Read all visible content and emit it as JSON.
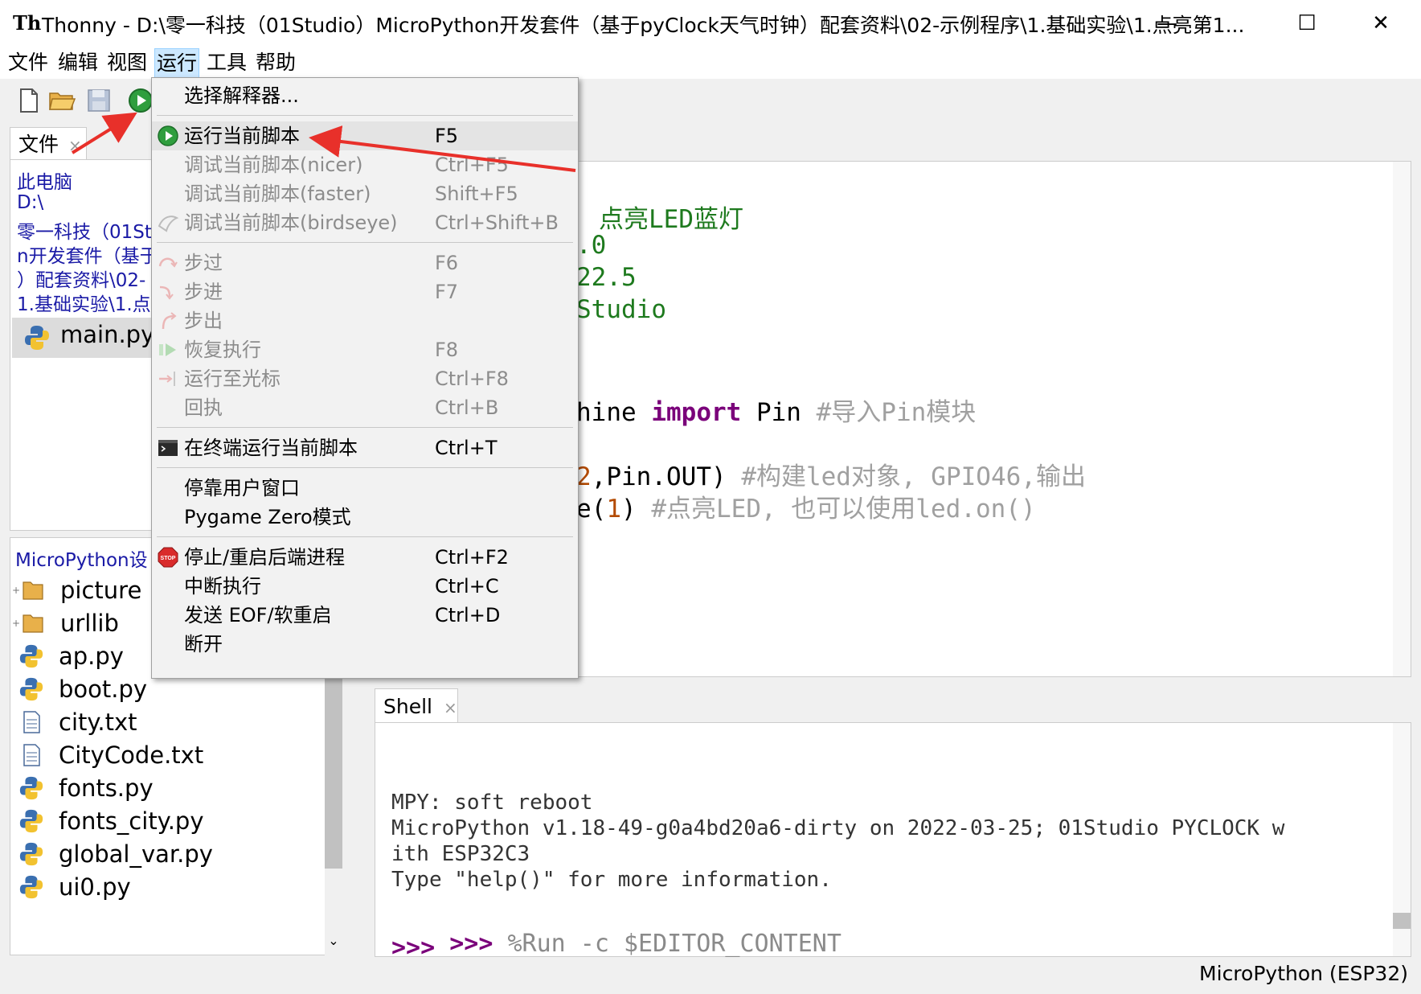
{
  "window": {
    "title": "Thonny  -  D:\\零一科技（01Studio）MicroPython开发套件（基于pyClock天气时钟）配套资料\\02-示例程序\\1.基础实验\\1.点亮第1...",
    "minimize": "—",
    "maximize": "☐",
    "close": "✕"
  },
  "menubar": [
    "文件",
    "编辑",
    "视图",
    "运行",
    "工具",
    "帮助"
  ],
  "toolbar_icons": [
    "new-file-icon",
    "open-folder-icon",
    "save-icon",
    "run-icon"
  ],
  "files_panel": {
    "tab_label": "文件",
    "tab_close": "×",
    "path_lines": [
      "此电脑",
      "D:\\",
      "零一科技（01St",
      "n开发套件（基于",
      "）配套资料\\02-",
      "1.基础实验\\1.点"
    ],
    "selected_file": "main.py"
  },
  "device_panel": {
    "title": "MicroPython设",
    "items": [
      {
        "name": "picture",
        "kind": "folder"
      },
      {
        "name": "urllib",
        "kind": "folder"
      },
      {
        "name": "ap.py",
        "kind": "python"
      },
      {
        "name": "boot.py",
        "kind": "python"
      },
      {
        "name": "city.txt",
        "kind": "text"
      },
      {
        "name": "CityCode.txt",
        "kind": "text"
      },
      {
        "name": "fonts.py",
        "kind": "python"
      },
      {
        "name": "fonts_city.py",
        "kind": "python"
      },
      {
        "name": "global_var.py",
        "kind": "python"
      },
      {
        "name": "ui0.py",
        "kind": "python"
      }
    ]
  },
  "editor": {
    "lines": [
      {
        "parts": [
          {
            "t": "点亮LED蓝灯",
            "c": "#1e7a1e"
          }
        ]
      },
      {
        "parts": [
          {
            "t": ".0",
            "c": "#1e7a1e"
          }
        ]
      },
      {
        "parts": [
          {
            "t": "22.5",
            "c": "#1e7a1e"
          }
        ]
      },
      {
        "parts": [
          {
            "t": "Studio",
            "c": "#1e7a1e"
          }
        ]
      },
      {
        "parts": [
          {
            "t": "hine ",
            "c": "#000"
          },
          {
            "t": "import",
            "c": "#7a007a"
          },
          {
            "t": " Pin ",
            "c": "#000"
          },
          {
            "t": "#导入Pin模块",
            "c": "#a0a0a0"
          }
        ]
      },
      {
        "parts": [
          {
            "t": "2",
            "c": "#b34a00"
          },
          {
            "t": ",Pin.OUT) ",
            "c": "#000"
          },
          {
            "t": "#构建led对象, GPIO46,输出",
            "c": "#a0a0a0"
          }
        ]
      },
      {
        "parts": [
          {
            "t": "e(",
            "c": "#000"
          },
          {
            "t": "1",
            "c": "#b34a00"
          },
          {
            "t": ") ",
            "c": "#000"
          },
          {
            "t": "#点亮LED, 也可以使用led.on()",
            "c": "#a0a0a0"
          }
        ]
      }
    ]
  },
  "shell": {
    "tab_label": "Shell",
    "tab_close": "×",
    "lines": [
      "MPY: soft reboot",
      "MicroPython v1.18-49-g0a4bd20a6-dirty on 2022-03-25; 01Studio PYCLOCK w",
      "ith ESP32C3",
      "Type \"help()\" for more information."
    ],
    "prompt": ">>>",
    "command": " %Run -c $EDITOR_CONTENT",
    "prompt2": ">>>"
  },
  "status": "MicroPython (ESP32)",
  "run_menu": [
    {
      "label": "选择解释器...",
      "shortcut": "",
      "disabled": false,
      "icon": ""
    },
    {
      "sep": true
    },
    {
      "label": "运行当前脚本",
      "shortcut": "F5",
      "disabled": false,
      "icon": "run-icon"
    },
    {
      "label": "调试当前脚本(nicer)",
      "shortcut": "Ctrl+F5",
      "disabled": true,
      "icon": ""
    },
    {
      "label": "调试当前脚本(faster)",
      "shortcut": "Shift+F5",
      "disabled": true,
      "icon": ""
    },
    {
      "label": "调试当前脚本(birdseye)",
      "shortcut": "Ctrl+Shift+B",
      "disabled": true,
      "icon": "birdseye-icon"
    },
    {
      "sep": true
    },
    {
      "label": "步过",
      "shortcut": "F6",
      "disabled": true,
      "icon": "step-over-icon"
    },
    {
      "label": "步进",
      "shortcut": "F7",
      "disabled": true,
      "icon": "step-into-icon"
    },
    {
      "label": "步出",
      "shortcut": "",
      "disabled": true,
      "icon": "step-out-icon"
    },
    {
      "label": "恢复执行",
      "shortcut": "F8",
      "disabled": true,
      "icon": "resume-icon"
    },
    {
      "label": "运行至光标",
      "shortcut": "Ctrl+F8",
      "disabled": true,
      "icon": "run-to-cursor-icon"
    },
    {
      "label": "回执",
      "shortcut": "Ctrl+B",
      "disabled": true,
      "icon": ""
    },
    {
      "sep": true
    },
    {
      "label": "在终端运行当前脚本",
      "shortcut": "Ctrl+T",
      "disabled": false,
      "icon": "terminal-icon"
    },
    {
      "sep": true
    },
    {
      "label": "停靠用户窗口",
      "shortcut": "",
      "disabled": false,
      "icon": ""
    },
    {
      "label": "Pygame Zero模式",
      "shortcut": "",
      "disabled": false,
      "icon": ""
    },
    {
      "sep": true
    },
    {
      "label": "停止/重启后端进程",
      "shortcut": "Ctrl+F2",
      "disabled": false,
      "icon": "stop-icon"
    },
    {
      "label": "中断执行",
      "shortcut": "Ctrl+C",
      "disabled": false,
      "icon": ""
    },
    {
      "label": "发送 EOF/软重启",
      "shortcut": "Ctrl+D",
      "disabled": false,
      "icon": ""
    },
    {
      "label": "断开",
      "shortcut": "",
      "disabled": false,
      "icon": ""
    }
  ],
  "colors": {
    "annotation_arrow": "#e8302a",
    "menu_active": "#cce8ff",
    "path_text": "#1a1aa6"
  }
}
